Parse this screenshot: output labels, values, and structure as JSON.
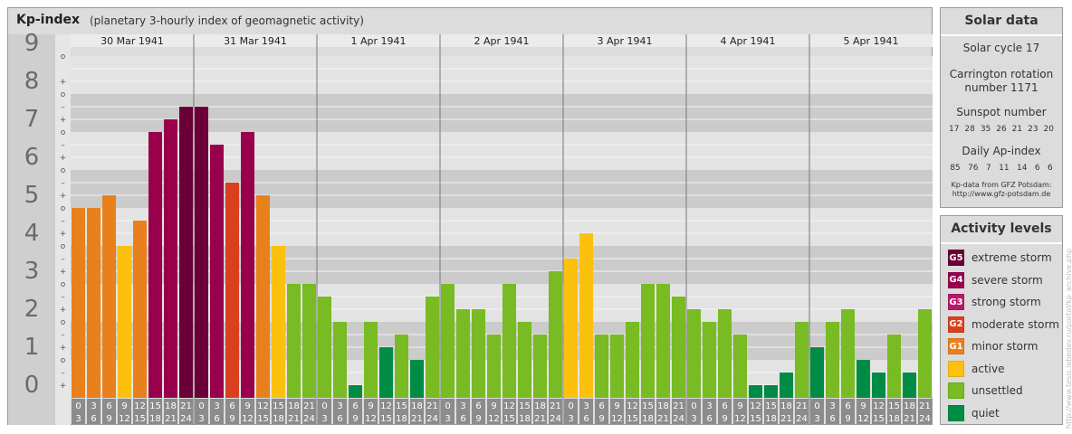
{
  "header": {
    "title": "Kp-index",
    "subtitle": "(planetary 3-hourly index of geomagnetic activity)"
  },
  "chart_data": {
    "type": "bar",
    "ylim": [
      0,
      9
    ],
    "y_ticks": [
      "0",
      "1",
      "2",
      "3",
      "4",
      "5",
      "6",
      "7",
      "8",
      "9"
    ],
    "minor_tick_labels": [
      "–",
      "o",
      "+"
    ],
    "days": [
      "30 Mar 1941",
      "31 Mar 1941",
      "1 Apr 1941",
      "2 Apr 1941",
      "3 Apr 1941",
      "4 Apr 1941",
      "5 Apr 1941"
    ],
    "hour_ticks_top": [
      "0",
      "3",
      "6",
      "9",
      "12",
      "15",
      "18",
      "21"
    ],
    "hour_ticks_bottom": [
      "3",
      "6",
      "9",
      "12",
      "15",
      "18",
      "21",
      "24"
    ],
    "values": [
      5.0,
      5.0,
      5.333,
      4.0,
      4.667,
      7.0,
      7.333,
      7.667,
      7.667,
      6.667,
      5.667,
      7.0,
      5.333,
      4.0,
      3.0,
      3.0,
      2.667,
      2.0,
      0.333,
      2.0,
      1.333,
      1.667,
      1.0,
      2.667,
      3.0,
      2.333,
      2.333,
      1.667,
      3.0,
      2.0,
      1.667,
      3.333,
      3.667,
      4.333,
      1.667,
      1.667,
      2.0,
      3.0,
      3.0,
      2.667,
      2.333,
      2.0,
      2.333,
      1.667,
      0.333,
      0.333,
      0.667,
      2.0,
      1.333,
      2.0,
      2.333,
      1.0,
      0.667,
      1.667,
      0.667,
      2.333
    ]
  },
  "solar": {
    "heading": "Solar data",
    "cycle": "Solar cycle 17",
    "carrington_line1": "Carrington rotation",
    "carrington_line2": "number 1171",
    "sunspot_label": "Sunspot number",
    "sunspot_values": [
      "17",
      "28",
      "35",
      "26",
      "21",
      "23",
      "20"
    ],
    "ap_label": "Daily Ap-index",
    "ap_values": [
      "85",
      "76",
      "7",
      "11",
      "14",
      "6",
      "6"
    ],
    "source_line1": "Kp-data from GFZ Potsdam:",
    "source_line2": "http://www.gfz-potsdam.de"
  },
  "activity": {
    "heading": "Activity levels",
    "levels": [
      {
        "code": "G5",
        "label": "extreme storm",
        "color": "#6b0038"
      },
      {
        "code": "G4",
        "label": "severe storm",
        "color": "#99004c"
      },
      {
        "code": "G3",
        "label": "strong storm",
        "color": "#b8196a"
      },
      {
        "code": "G2",
        "label": "moderate storm",
        "color": "#d9401e"
      },
      {
        "code": "G1",
        "label": "minor storm",
        "color": "#e8801c"
      },
      {
        "code": "",
        "label": "active",
        "color": "#fcc10e"
      },
      {
        "code": "",
        "label": "unsettled",
        "color": "#78bb22"
      },
      {
        "code": "",
        "label": "quiet",
        "color": "#008c45"
      }
    ]
  },
  "watermark": "http://www.tesis.lebedev.ru/portal/kp_archive.php"
}
